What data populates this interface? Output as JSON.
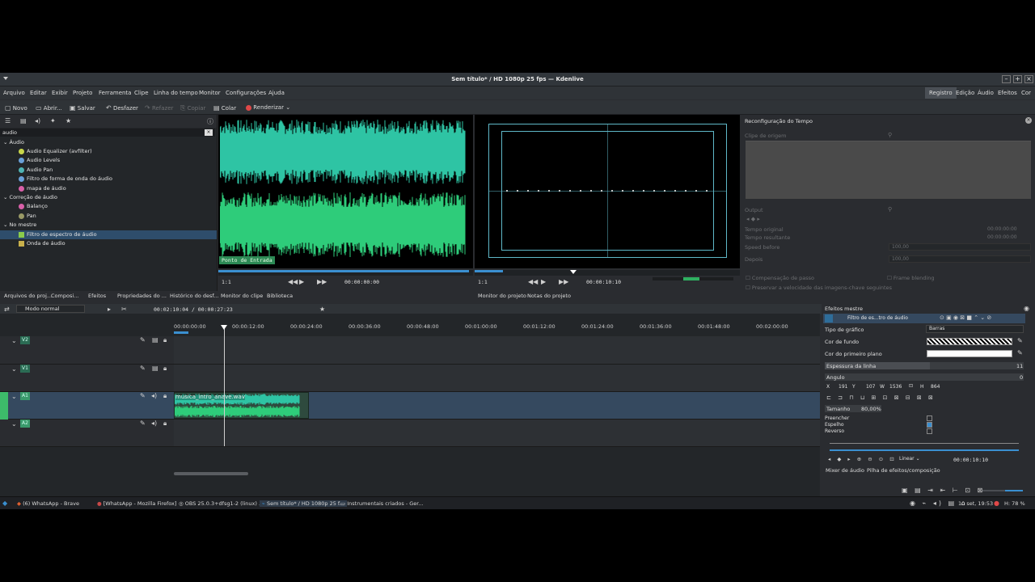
{
  "window": {
    "title": "Sem título* / HD 1080p 25 fps — Kdenlive"
  },
  "menu": [
    "Arquivo",
    "Editar",
    "Exibir",
    "Projeto",
    "Ferramenta",
    "Clipe",
    "Linha do tempo",
    "Monitor",
    "Configurações",
    "Ajuda"
  ],
  "layouts": [
    "Registro",
    "Edição",
    "Áudio",
    "Efeitos",
    "Cor"
  ],
  "toolbar": {
    "new": "Novo",
    "open": "Abrir...",
    "save": "Salvar",
    "undo": "Desfazer",
    "redo": "Refazer",
    "copy": "Copiar",
    "paste": "Colar",
    "render": "Renderizar"
  },
  "effects": {
    "search_value": "audio",
    "items": [
      {
        "label": "Áudio",
        "level": 0
      },
      {
        "label": "Audio Equalizer (avfilter)",
        "level": 1,
        "color": "#c8d64b"
      },
      {
        "label": "Audio Levels",
        "level": 1,
        "color": "#6aa0d8"
      },
      {
        "label": "Audio Pan",
        "level": 1,
        "color": "#4fb4b4"
      },
      {
        "label": "Filtro de forma de onda do áudio",
        "level": 1,
        "color": "#6aa0d8"
      },
      {
        "label": "mapa de áudio",
        "level": 1,
        "color": "#d860a8"
      },
      {
        "label": "Correção de áudio",
        "level": 0
      },
      {
        "label": "Balanço",
        "level": 1,
        "color": "#d860a8"
      },
      {
        "label": "Pan",
        "level": 1,
        "color": "#999966"
      },
      {
        "label": "No mestre",
        "level": 0
      },
      {
        "label": "Filtro de espectro de áudio",
        "level": 1,
        "color": "#8acb4b",
        "selected": true
      },
      {
        "label": "Onda de áudio",
        "level": 1,
        "color": "#c8b04b"
      }
    ]
  },
  "left_tabs": [
    "Arquivos do proj...",
    "Composi...",
    "Efeitos",
    "Propriedades do ...",
    "Histórico do desf...",
    "Monitor do clipe",
    "Biblioteca"
  ],
  "clip_monitor": {
    "overlay": "Ponto de Entrada",
    "zoom": "1:1",
    "timecode": "00:00:00:00"
  },
  "project_monitor": {
    "zoom": "1:1",
    "timecode": "00:00:10:10"
  },
  "monitor_tabs": [
    "Monitor do projeto",
    "Notas do projeto"
  ],
  "time_remap": {
    "title": "Reconfiguração do Tempo",
    "source_clip": "Clipe de origem",
    "output": "Output",
    "original_time": "Tempo original",
    "original_value": "00:00:00:00",
    "resulting_time": "Tempo resultante",
    "resulting_value": "00:00:00:00",
    "speed_before": "Speed before",
    "speed_before_value": "100,00",
    "after": "Depois",
    "after_value": "100,00",
    "pitch_comp": "Compensação de passo",
    "frame_blending": "Frame blending",
    "preserve": "Preservar a velocidade das imagens-chave seguintes"
  },
  "timeline": {
    "mode": "Modo normal",
    "position": "00:02:10:04 / 00:00:27:23",
    "ruler": [
      "00:00:00:00",
      "00:00:12:00",
      "00:00:24:00",
      "00:00:36:00",
      "00:00:48:00",
      "00:01:00:00",
      "00:01:12:00",
      "00:01:24:00",
      "00:01:36:00",
      "00:01:48:00",
      "00:02:00:00"
    ],
    "tracks": [
      "V2",
      "V1",
      "A1",
      "A2"
    ],
    "clip_name": "musica_intro_anave.wav"
  },
  "master_effects": {
    "title": "Efeitos mestre",
    "effect_name": "Filtro de es...tro de áudio",
    "graph_type_label": "Tipo de gráfico",
    "graph_type_value": "Barras",
    "bg_color_label": "Cor de fundo",
    "fg_color_label": "Cor do primeiro plano",
    "line_thickness_label": "Espessura da linha",
    "line_thickness_value": "11",
    "angle_label": "Angulo",
    "angle_value": "0",
    "x": "191",
    "y": "107",
    "w": "1536",
    "h": "864",
    "size_label": "Tamanho",
    "size_value": "80,00%",
    "fill": "Preencher",
    "mirror": "Espelho",
    "reverse": "Reverso",
    "interp": "Linear",
    "timecode": "00:00:10:10",
    "tabs": [
      "Mixer de áudio",
      "Pilha de efeitos/composição"
    ]
  },
  "taskbar": {
    "items": [
      "(6) WhatsApp - Brave",
      "[WhatsApp - Mozilla Firefox]",
      "OBS 25.0.3+dfsg1-2 (linux) ...",
      "Sem título* / HD 1080p 25 f...",
      "Instrumentais criados - Ger..."
    ],
    "clock": "10 set, 19:53",
    "battery": "H: 78 %"
  }
}
